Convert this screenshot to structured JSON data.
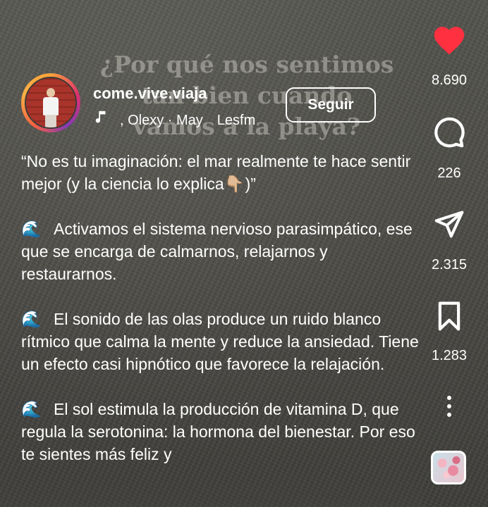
{
  "background_overlay_title": [
    "¿Por qué nos sentimos",
    "tan bien cuando",
    "vamos a la playa?"
  ],
  "post": {
    "username": "come.vive.viaja",
    "music_artist": ", Olexy · May",
    "music_label": "Lesfm",
    "follow_label": "Seguir"
  },
  "caption": {
    "intro_a": "“No es tu imaginación: el mar realmente te hace sentir mejor (y la ciencia lo explica",
    "intro_b": ")”",
    "point_1": "Activamos el sistema nervioso parasimpático, ese que se encarga de calmarnos, relajarnos y restaurarnos.",
    "point_2": "El sonido de las olas produce un ruido blanco rítmico que calma la mente y reduce la ansiedad. Tiene un efecto casi hipnótico que favorece la relajación.",
    "point_3": "El sol estimula la producción de vitamina D, que regula la serotonina: la hormona del bienestar. Por eso te sientes más feliz y"
  },
  "actions": {
    "likes": "8.690",
    "comments": "226",
    "shares": "2.315",
    "saves": "1.283"
  },
  "icons": {
    "like": "heart-icon",
    "comment": "comment-icon",
    "share": "send-icon",
    "save": "bookmark-icon",
    "more": "more-vertical-icon",
    "music": "music-note-icon",
    "wave": "water-wave-emoji",
    "pointing": "pointing-down-emoji"
  },
  "colors": {
    "like": "#ff3040",
    "text": "#ffffff",
    "background": "#4d4c47"
  }
}
